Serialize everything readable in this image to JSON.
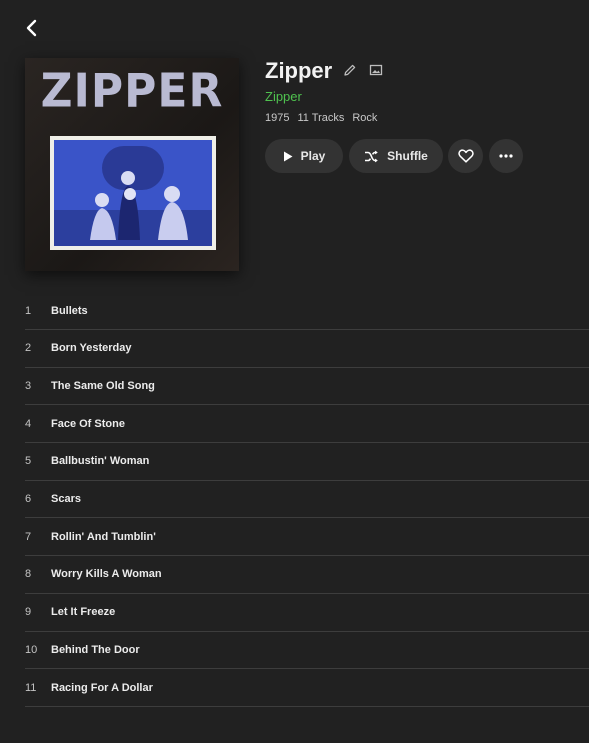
{
  "album": {
    "title": "Zipper",
    "artist": "Zipper",
    "year": "1975",
    "track_count": "11 Tracks",
    "genre": "Rock",
    "cover_text": "ZIPPER"
  },
  "actions": {
    "play_label": "Play",
    "shuffle_label": "Shuffle"
  },
  "colors": {
    "background": "#212121",
    "accent": "#4fc24f",
    "button": "#333333",
    "divider": "#3d3d3d"
  },
  "tracks": [
    {
      "num": "1",
      "title": "Bullets"
    },
    {
      "num": "2",
      "title": "Born Yesterday"
    },
    {
      "num": "3",
      "title": "The Same Old Song"
    },
    {
      "num": "4",
      "title": "Face Of Stone"
    },
    {
      "num": "5",
      "title": "Ballbustin' Woman"
    },
    {
      "num": "6",
      "title": "Scars"
    },
    {
      "num": "7",
      "title": "Rollin' And Tumblin'"
    },
    {
      "num": "8",
      "title": "Worry Kills A Woman"
    },
    {
      "num": "9",
      "title": "Let It Freeze"
    },
    {
      "num": "10",
      "title": "Behind The Door"
    },
    {
      "num": "11",
      "title": "Racing For A Dollar"
    }
  ]
}
